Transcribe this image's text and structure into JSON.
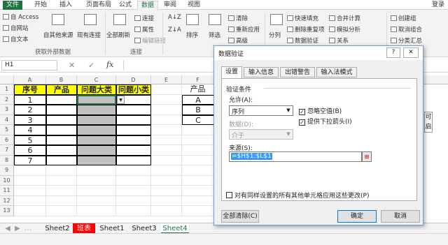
{
  "ribbon_tabs": [
    "文件",
    "开始",
    "插入",
    "页面布局",
    "公式",
    "数据",
    "审阅",
    "视图"
  ],
  "active_tab": "数据",
  "login_label": "登录",
  "ribbon": {
    "access": "自 Access",
    "web": "自网站",
    "text": "自文本",
    "other_sources": "自其他来源",
    "existing_conn": "现有连接",
    "refresh_all": "全部刷新",
    "connections": "连接",
    "properties": "属性",
    "edit_links": "编辑链接",
    "sort": "排序",
    "filter": "筛选",
    "clear": "清除",
    "reapply": "重新应用",
    "advanced": "高级",
    "split": "分列",
    "flash_fill": "快速填充",
    "remove_dup": "删除重复项",
    "data_validation": "数据验证",
    "consolidate": "合并计算",
    "what_if": "模拟分析",
    "relationships": "关系",
    "group": "创建组",
    "ungroup": "取消组合",
    "subtotal": "分类汇总",
    "group_get_external": "获取外部数据",
    "group_connections": "连接"
  },
  "formula_bar": {
    "name_box": "H1",
    "fx": "fx",
    "value": ""
  },
  "columns": [
    "A",
    "B",
    "C",
    "D",
    "E",
    "F"
  ],
  "rows": [
    "1",
    "2",
    "3",
    "4",
    "5",
    "6",
    "7",
    "8",
    "9",
    "10",
    "11",
    "12",
    "13"
  ],
  "table_headers": [
    "序号",
    "产品",
    "问题大类",
    "问题小类"
  ],
  "seq_numbers": [
    "1",
    "2",
    "3",
    "4",
    "5",
    "6",
    "7"
  ],
  "product_header": "产品",
  "products": [
    "A",
    "B",
    "C"
  ],
  "right_edge_text": [
    "可",
    "启"
  ],
  "sheet_tabs": [
    "Sheet2",
    "班表",
    "Sheet1",
    "Sheet3",
    "Sheet4"
  ],
  "active_sheet": "Sheet4",
  "colors": {
    "accent": "#217346",
    "header_yellow": "#ffff00",
    "gray_fill": "#c0c0c0",
    "red_tab": "#ff0000"
  },
  "dialog": {
    "title": "数据验证",
    "help": "?",
    "close": "✕",
    "tabs": [
      "设置",
      "输入信息",
      "出错警告",
      "输入法模式"
    ],
    "criteria_label": "验证条件",
    "allow_label": "允许(A):",
    "allow_value": "序列",
    "ignore_blank": "忽略空值(B)",
    "dropdown_arrow": "提供下拉箭头(I)",
    "data_label": "数据(D):",
    "data_value": "介于",
    "source_label": "来源(S):",
    "source_value": "=$H$1:$L$1",
    "apply_all": "对有同样设置的所有其他单元格应用这些更改(P)",
    "clear_all": "全部清除(C)",
    "ok": "确定",
    "cancel": "取消"
  }
}
